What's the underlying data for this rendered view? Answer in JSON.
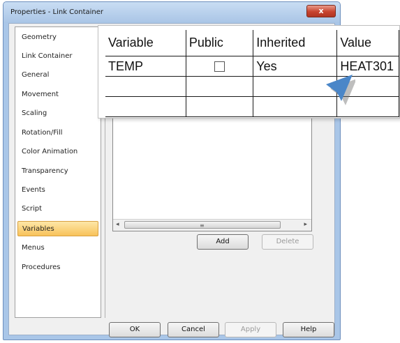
{
  "window": {
    "title": "Properties - Link Container",
    "close_glyph": "x"
  },
  "nav": {
    "items": [
      {
        "label": "Geometry"
      },
      {
        "label": "Link Container"
      },
      {
        "label": "General"
      },
      {
        "label": "Movement"
      },
      {
        "label": "Scaling"
      },
      {
        "label": "Rotation/Fill"
      },
      {
        "label": "Color Animation"
      },
      {
        "label": "Transparency"
      },
      {
        "label": "Events"
      },
      {
        "label": "Script"
      },
      {
        "label": "Variables"
      },
      {
        "label": "Menus"
      },
      {
        "label": "Procedures"
      }
    ],
    "selected": "Variables"
  },
  "variables_table": {
    "columns": [
      "Variable",
      "Public",
      "Inherited",
      "Value"
    ],
    "rows": [
      {
        "variable": "TEMP",
        "public": false,
        "inherited": "Yes",
        "value": "HEAT301"
      },
      {
        "variable": "",
        "public": null,
        "inherited": "",
        "value": ""
      },
      {
        "variable": "",
        "public": null,
        "inherited": "",
        "value": ""
      }
    ]
  },
  "scrollbar": {
    "left_arrow": "◂",
    "right_arrow": "▸",
    "grip": "≡"
  },
  "variable_buttons": {
    "add_label": "Add",
    "delete_label": "Delete"
  },
  "footer": {
    "ok_label": "OK",
    "cancel_label": "Cancel",
    "apply_label": "Apply",
    "help_label": "Help"
  },
  "icons": {
    "close": "close-icon",
    "cursor": "mouse-pointer-icon",
    "checkbox": "checkbox-icon"
  },
  "colors": {
    "selection": "#f8c25a",
    "titlebar": "#a9c5e6",
    "cursor": "#4a86c8",
    "close": "#c8432e"
  }
}
